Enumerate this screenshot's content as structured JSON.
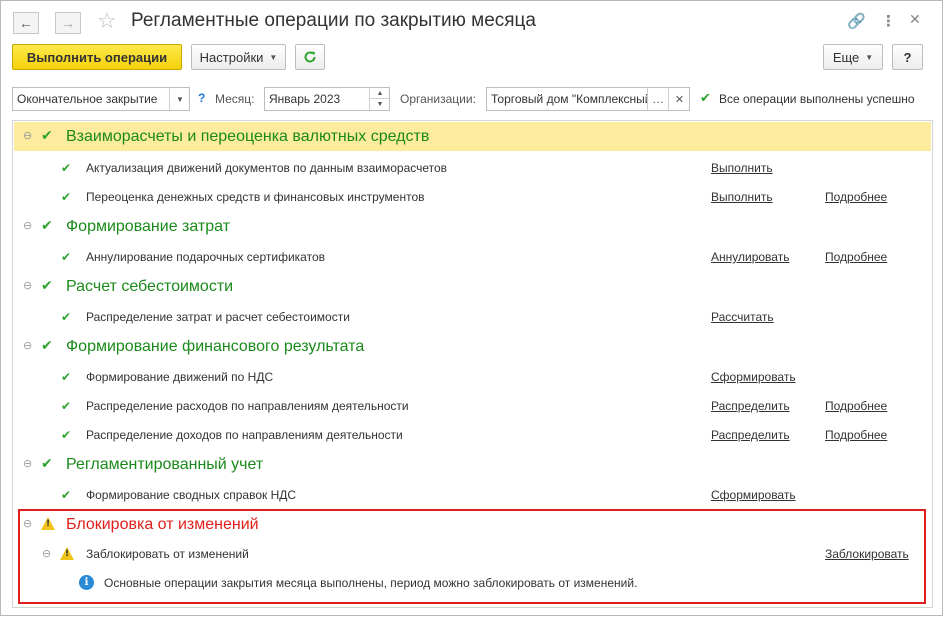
{
  "window": {
    "title": "Регламентные операции по закрытию месяца",
    "back_icon": "arrow-left",
    "forward_icon": "arrow-right",
    "favorite_icon": "star"
  },
  "toolbar": {
    "run_label": "Выполнить операции",
    "settings_label": "Настройки",
    "more_label": "Еще",
    "help_label": "?"
  },
  "filters": {
    "mode_value": "Окончательное закрытие",
    "help_mark": "?",
    "month_label": "Месяц:",
    "month_value": "Январь 2023",
    "org_label": "Организации:",
    "org_value": "Торговый дом \"Комплексный\"",
    "status_text": "Все операции выполнены успешно"
  },
  "groups": [
    {
      "title": "Взаиморасчеты и переоценка валютных средств",
      "items": [
        {
          "label": "Актуализация движений документов по данным взаиморасчетов",
          "action": "Выполнить",
          "details": ""
        },
        {
          "label": "Переоценка денежных средств и финансовых инструментов",
          "action": "Выполнить",
          "details": "Подробнее"
        }
      ]
    },
    {
      "title": "Формирование затрат",
      "items": [
        {
          "label": "Аннулирование подарочных сертификатов",
          "action": "Аннулировать",
          "details": "Подробнее"
        }
      ]
    },
    {
      "title": "Расчет себестоимости",
      "items": [
        {
          "label": "Распределение затрат и расчет себестоимости",
          "action": "Рассчитать",
          "details": ""
        }
      ]
    },
    {
      "title": "Формирование финансового результата",
      "items": [
        {
          "label": "Формирование движений по НДС",
          "action": "Сформировать",
          "details": ""
        },
        {
          "label": "Распределение расходов по направлениям деятельности",
          "action": "Распределить",
          "details": "Подробнее"
        },
        {
          "label": "Распределение доходов по направлениям деятельности",
          "action": "Распределить",
          "details": "Подробнее"
        }
      ]
    },
    {
      "title": "Регламентированный учет",
      "items": [
        {
          "label": "Формирование сводных справок НДС",
          "action": "Сформировать",
          "details": ""
        }
      ]
    }
  ],
  "lock_group": {
    "title": "Блокировка от изменений",
    "item_label": "Заблокировать от изменений",
    "item_action": "Заблокировать",
    "info_text": "Основные операции закрытия месяца выполнены, период можно заблокировать от изменений."
  },
  "colors": {
    "accent_yellow": "#f5d20b",
    "success_green": "#2da42d",
    "group_title_green": "#1a8a1a",
    "highlight_row": "#fdeb9e",
    "warning_red": "#e41b1b"
  }
}
